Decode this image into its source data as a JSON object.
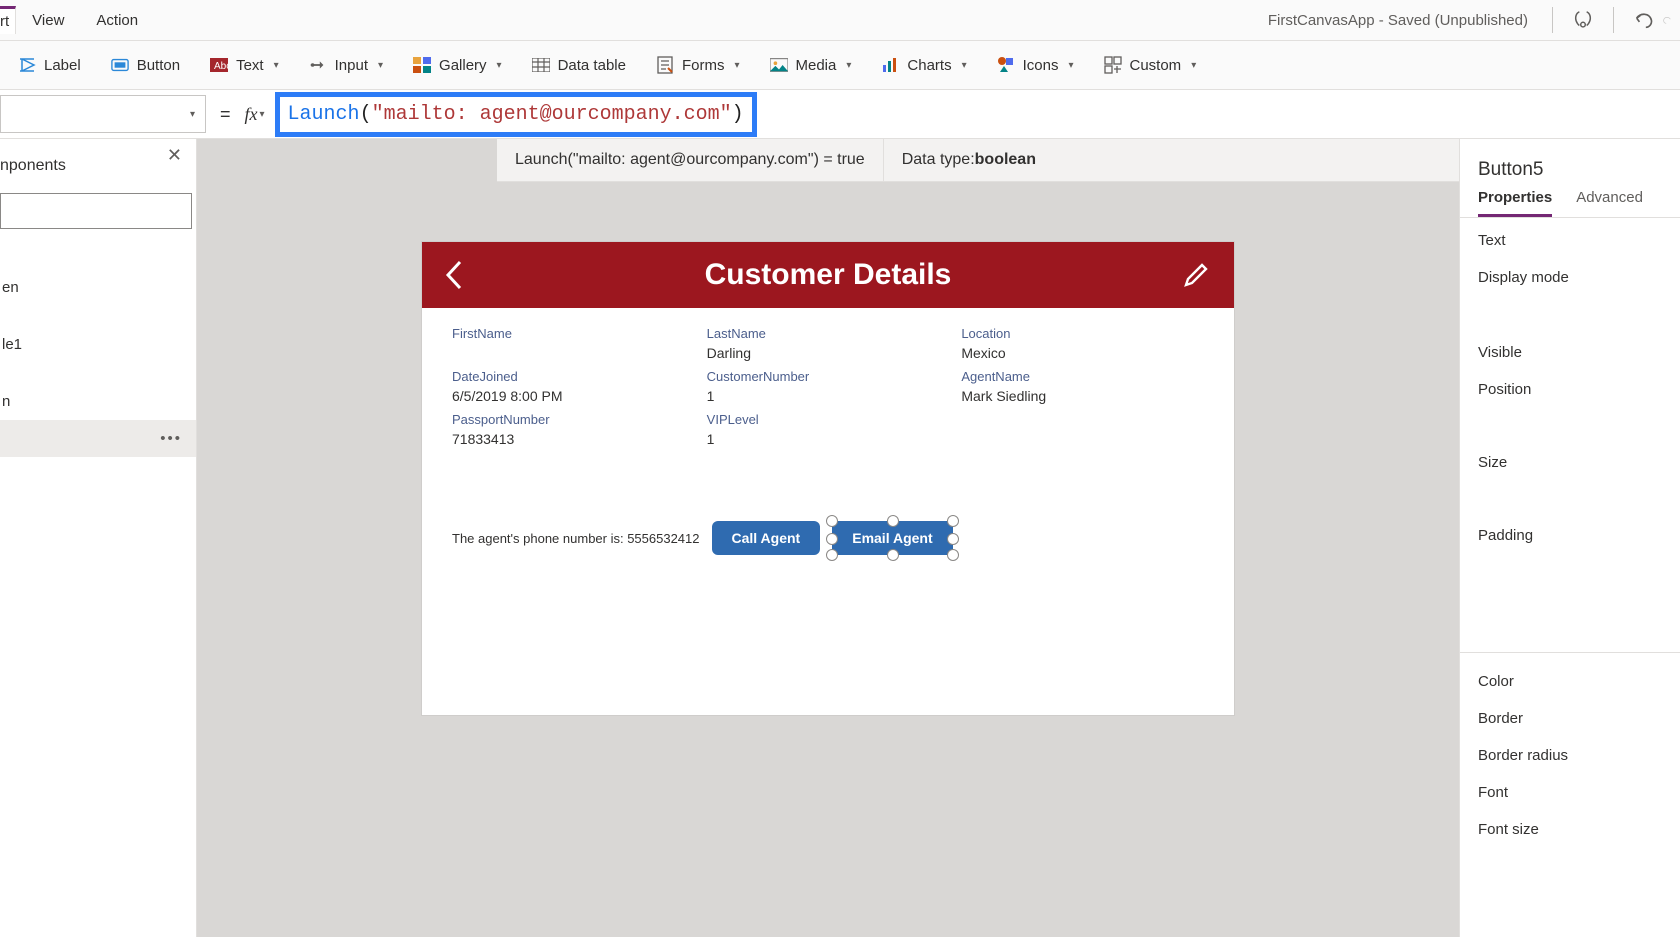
{
  "menu": {
    "partial_tab": "rt",
    "items": [
      "View",
      "Action"
    ]
  },
  "title": {
    "app_name": "FirstCanvasApp",
    "status": "Saved (Unpublished)"
  },
  "ribbon": [
    {
      "icon": "label-icon",
      "label": "Label",
      "chevron": false
    },
    {
      "icon": "button-icon",
      "label": "Button",
      "chevron": false
    },
    {
      "icon": "text-icon",
      "label": "Text",
      "chevron": true
    },
    {
      "icon": "input-icon",
      "label": "Input",
      "chevron": true
    },
    {
      "icon": "gallery-icon",
      "label": "Gallery",
      "chevron": true
    },
    {
      "icon": "table-icon",
      "label": "Data table",
      "chevron": false
    },
    {
      "icon": "forms-icon",
      "label": "Forms",
      "chevron": true
    },
    {
      "icon": "media-icon",
      "label": "Media",
      "chevron": true
    },
    {
      "icon": "charts-icon",
      "label": "Charts",
      "chevron": true
    },
    {
      "icon": "icons-icon",
      "label": "Icons",
      "chevron": true
    },
    {
      "icon": "custom-icon",
      "label": "Custom",
      "chevron": true
    }
  ],
  "formula": {
    "property_selected": "",
    "fn": "Launch",
    "open": "(",
    "str": "\"mailto: agent@ourcompany.com\"",
    "close": ")",
    "eval_text": "Launch(\"mailto: agent@ourcompany.com\")  =  true",
    "datatype_label": "Data type: ",
    "datatype_value": "boolean"
  },
  "tree": {
    "tab": "nponents",
    "items": [
      "",
      "en",
      "",
      "le1",
      "",
      "n"
    ],
    "selected": ""
  },
  "app": {
    "title": "Customer Details",
    "fields": [
      {
        "label": "FirstName",
        "value": ""
      },
      {
        "label": "LastName",
        "value": "Darling"
      },
      {
        "label": "Location",
        "value": "Mexico"
      },
      {
        "label": "DateJoined",
        "value": "6/5/2019 8:00 PM"
      },
      {
        "label": "CustomerNumber",
        "value": "1"
      },
      {
        "label": "AgentName",
        "value": "Mark Siedling"
      },
      {
        "label": "PassportNumber",
        "value": "71833413"
      },
      {
        "label": "VIPLevel",
        "value": "1"
      }
    ],
    "agent_phone_label": "The agent's phone number is:  5556532412",
    "call_btn": "Call Agent",
    "email_btn": "Email Agent"
  },
  "rp": {
    "control": "Button5",
    "tabs": {
      "properties": "Properties",
      "advanced": "Advanced"
    },
    "rows_a": [
      "Text",
      "Display mode"
    ],
    "rows_b": [
      "Visible",
      "Position",
      "Size",
      "Padding"
    ],
    "rows_c": [
      "Color",
      "Border",
      "Border radius",
      "Font",
      "Font size"
    ]
  }
}
